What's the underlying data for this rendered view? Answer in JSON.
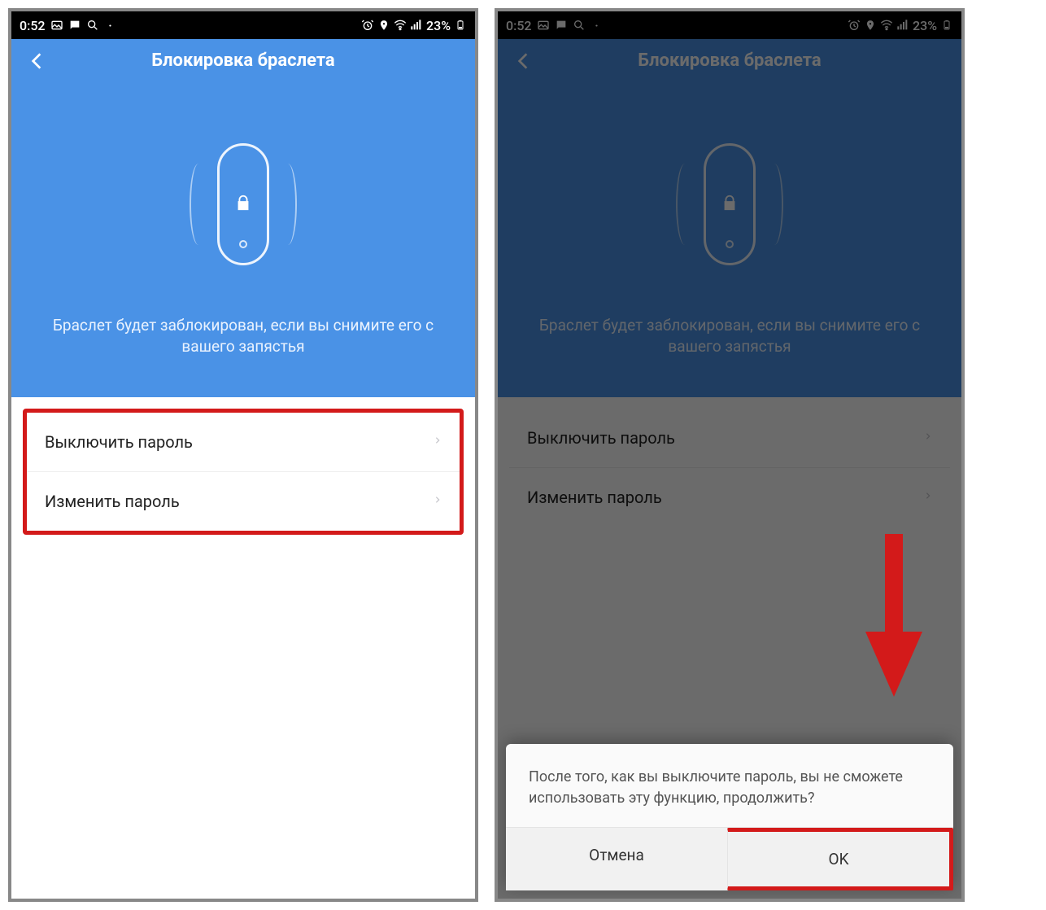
{
  "status": {
    "time": "0:52",
    "battery_pct": "23%",
    "icons_left": [
      "image-icon",
      "chat-icon",
      "search-icon",
      "dot-icon"
    ],
    "icons_right": [
      "alarm-icon",
      "location-icon",
      "wifi-icon",
      "signal-icon",
      "battery-icon"
    ]
  },
  "screen": {
    "title": "Блокировка браслета",
    "hero_desc": "Браслет будет заблокирован, если вы снимите его с вашего запястья",
    "menu": {
      "disable_password": "Выключить пароль",
      "change_password": "Изменить пароль"
    }
  },
  "dialog": {
    "message": "После того, как вы выключите пароль, вы не сможете использовать эту функцию, продолжить?",
    "cancel": "Отмена",
    "ok": "OK"
  }
}
